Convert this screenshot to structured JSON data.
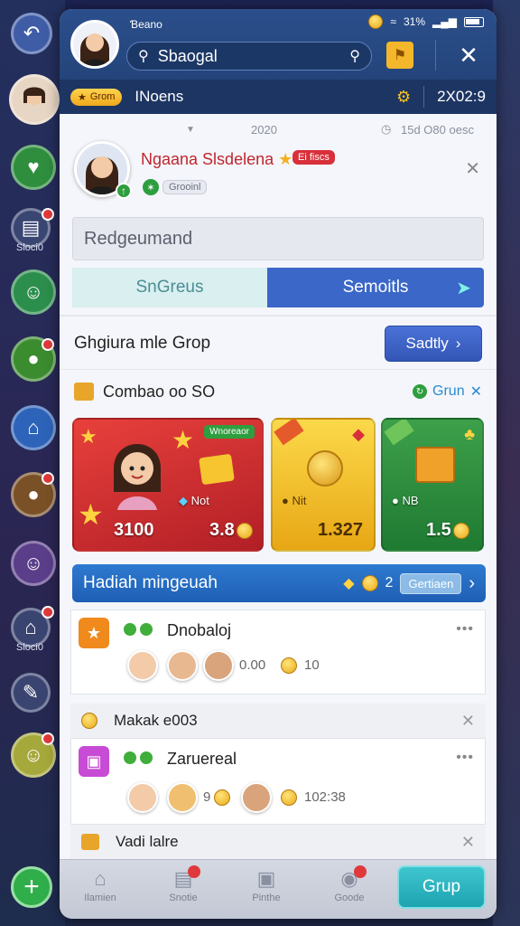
{
  "status": {
    "title": "Ɓeano",
    "battery": "31%"
  },
  "search": {
    "placeholder": "Sbaogal"
  },
  "subbar": {
    "badge": "Grom",
    "title": "INoens",
    "time": "2X02:9"
  },
  "infobar": {
    "center": "2020",
    "right": "15d O80 oesc"
  },
  "profile": {
    "name": "Ngaana Slsdelena",
    "badge": "Ei fiscs",
    "tag": "Grooinl"
  },
  "textfield": {
    "placeholder": "Redgeumand"
  },
  "segments": {
    "left": "SnGreus",
    "right": "Semoitls"
  },
  "group": {
    "title": "Ghgiura mle Grop",
    "button": "Sadtly"
  },
  "combo": {
    "title": "Combao oo SO",
    "link": "Grun"
  },
  "cards": [
    {
      "ribbon": "Wnoreaor",
      "note": "Not",
      "price": "3100",
      "price2": "3.8"
    },
    {
      "note": "Nit",
      "price": "1.327"
    },
    {
      "note": "NB",
      "price": "1.5"
    }
  ],
  "banner": {
    "title": "Hadiah mingeuah",
    "count": "2",
    "button": "Gertiaen"
  },
  "list": [
    {
      "title": "Dnobaloj",
      "count": "0.00",
      "coins": "10",
      "icon_color": "#f08a1d"
    },
    {
      "title": "Makak e003",
      "type": "simple"
    },
    {
      "title": "Zaruereal",
      "count": "9",
      "coins": "102:38",
      "icon_color": "#c74bd4"
    },
    {
      "title": "Vadi lalre",
      "type": "simple"
    }
  ],
  "tabs": [
    {
      "label": "Ilamien"
    },
    {
      "label": "Snotie",
      "badge": ""
    },
    {
      "label": "Pinthe"
    },
    {
      "label": "Goode",
      "badge": ""
    }
  ],
  "cta": "Grup",
  "sidebar": {
    "label1": "Sloci0",
    "label2": "Sloci0"
  },
  "colors": {
    "header": "#2b4f8c",
    "accent": "#3a67c8",
    "green": "#2e9e3e",
    "red": "#d8303a"
  }
}
